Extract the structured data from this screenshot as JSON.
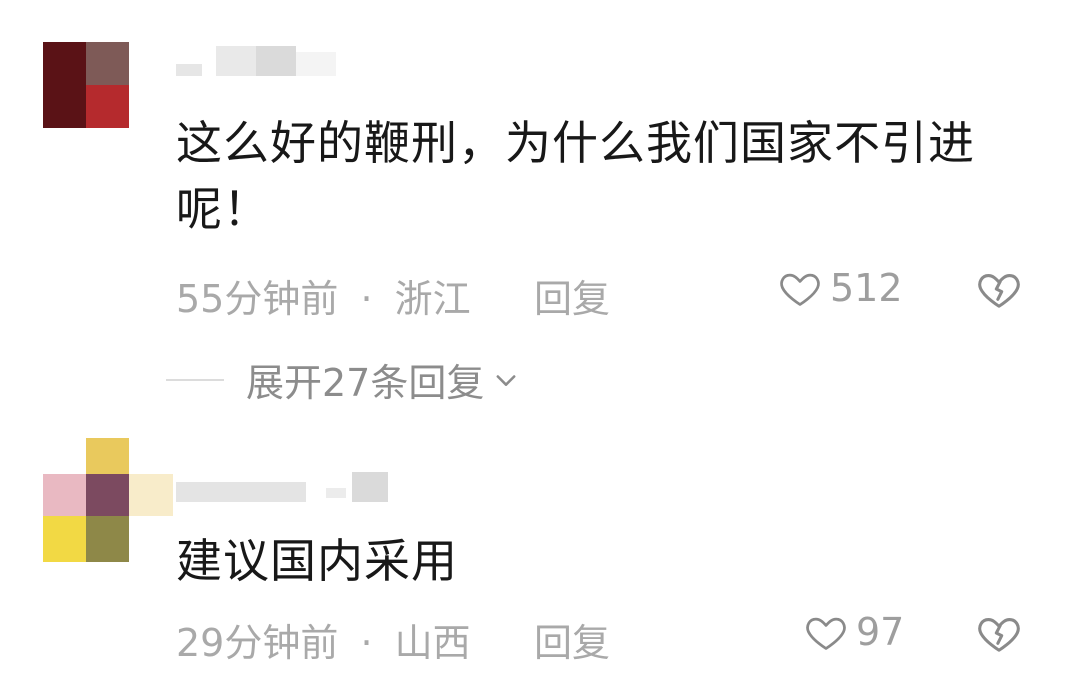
{
  "comments": [
    {
      "text": "这么好的鞭刑，为什么我们国家不引进呢！",
      "time": "55分钟前",
      "location": "浙江",
      "separator": "·",
      "reply_label": "回复",
      "likes": "512",
      "replies_toggle": "展开27条回复"
    },
    {
      "text": "建议国内采用",
      "time": "29分钟前",
      "location": "山西",
      "separator": "·",
      "reply_label": "回复",
      "likes": "97"
    }
  ],
  "colors": {
    "meta_gray": "#a9a9a9",
    "text": "#181818",
    "divider": "#dcdcdc"
  },
  "icons": [
    "heart-icon",
    "broken-heart-icon",
    "chevron-down-icon"
  ]
}
